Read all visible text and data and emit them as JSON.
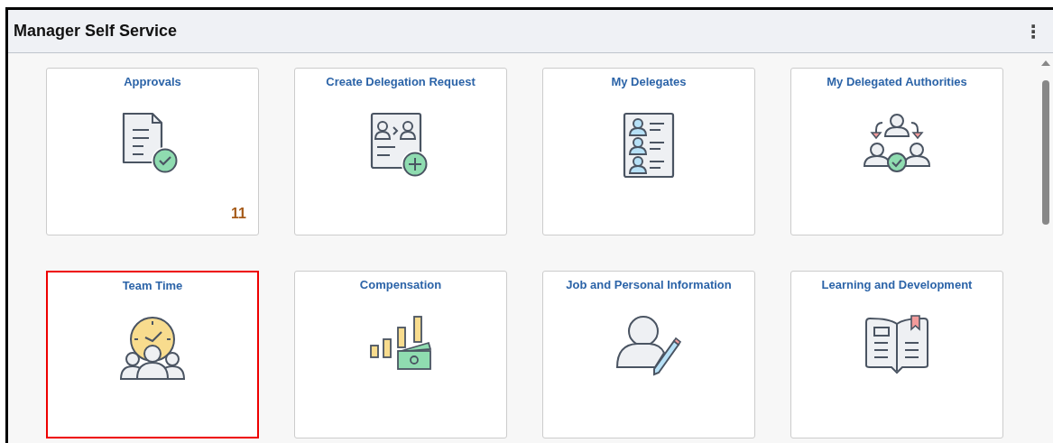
{
  "header": {
    "title": "Manager Self Service",
    "menu_glyph": "⋮"
  },
  "tiles": [
    {
      "title": "Approvals",
      "badge": "11",
      "highlighted": false
    },
    {
      "title": "Create Delegation Request",
      "highlighted": false
    },
    {
      "title": "My Delegates",
      "highlighted": false
    },
    {
      "title": "My Delegated Authorities",
      "highlighted": false
    },
    {
      "title": "Team Time",
      "highlighted": true
    },
    {
      "title": "Compensation",
      "highlighted": false
    },
    {
      "title": "Job and Personal Information",
      "highlighted": false
    },
    {
      "title": "Learning and Development",
      "highlighted": false
    }
  ]
}
